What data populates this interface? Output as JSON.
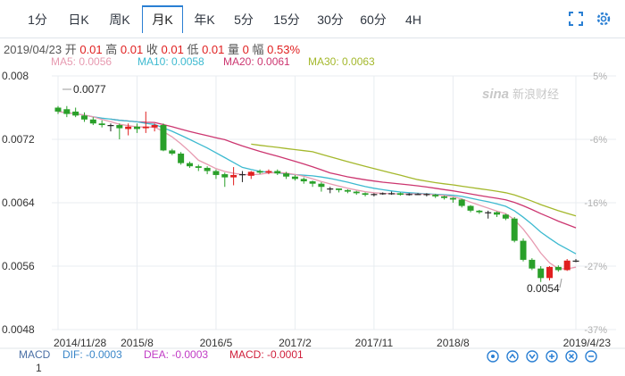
{
  "tabs": [
    "1分",
    "日K",
    "周K",
    "月K",
    "年K",
    "5分",
    "15分",
    "30分",
    "60分",
    "4H"
  ],
  "active_tab_index": 3,
  "info": {
    "date": "2019/04/23",
    "open_label": "开",
    "open": "0.01",
    "high_label": "高",
    "high": "0.01",
    "close_label": "收",
    "close": "0.01",
    "low_label": "低",
    "low": "0.01",
    "volume_label": "量",
    "volume": "0",
    "amp_label": "幅",
    "amp": "0.53%"
  },
  "ma": {
    "ma5": "MA5: 0.0056",
    "ma10": "MA10: 0.0058",
    "ma20": "MA20: 0.0061",
    "ma30": "MA30: 0.0063"
  },
  "colors": {
    "up": "#e02020",
    "down": "#2aa02a",
    "ma5": "#e79ab0",
    "ma10": "#3dbad0",
    "ma20": "#cc3670",
    "ma30": "#a4b82c",
    "macd_label": "#4a6fa5",
    "accent": "#2a7fd3"
  },
  "icons": {
    "fullscreen": "fullscreen-icon",
    "settings": "settings-icon"
  },
  "watermark": "新浪财经",
  "macd": {
    "title": "MACD",
    "dif": "DIF: -0.0003",
    "dea": "DEA: -0.0003",
    "macd": "MACD: -0.0001",
    "axis_top": "1"
  },
  "chart_data": {
    "type": "candlestick",
    "y_ticks": [
      "0.008",
      "0.0072",
      "0.0064",
      "0.0056",
      "0.0048"
    ],
    "pct_ticks": [
      "5%",
      "-6%",
      "-16%",
      "-27%",
      "-37%"
    ],
    "x_ticks": [
      "2014/11/28",
      "2015/8",
      "2016/5",
      "2017/2",
      "2017/11",
      "2018/8",
      "2019/4/23"
    ],
    "annotations": {
      "max": "0.0077",
      "min": "0.0054"
    },
    "ylim": [
      0.0048,
      0.008
    ],
    "candles": [
      [
        0.0076,
        0.00755,
        0.00762,
        0.00752
      ],
      [
        0.00758,
        0.00752,
        0.00762,
        0.00748
      ],
      [
        0.00755,
        0.0075,
        0.0076,
        0.00748
      ],
      [
        0.0075,
        0.00745,
        0.00754,
        0.00742
      ],
      [
        0.00745,
        0.0074,
        0.00748,
        0.00738
      ],
      [
        0.0074,
        0.00738,
        0.00744,
        0.00735
      ],
      [
        0.00738,
        0.00738,
        0.0074,
        0.0073
      ],
      [
        0.00738,
        0.00734,
        0.0074,
        0.0072
      ],
      [
        0.00733,
        0.00736,
        0.0074,
        0.00725
      ],
      [
        0.00736,
        0.00733,
        0.0074,
        0.00728
      ],
      [
        0.00734,
        0.00736,
        0.00755,
        0.00728
      ],
      [
        0.00735,
        0.00738,
        0.0074,
        0.0073
      ],
      [
        0.00738,
        0.00706,
        0.0074,
        0.00705
      ],
      [
        0.00706,
        0.00702,
        0.00708,
        0.007
      ],
      [
        0.00702,
        0.0069,
        0.00704,
        0.00688
      ],
      [
        0.0069,
        0.00686,
        0.00692,
        0.00684
      ],
      [
        0.00686,
        0.00684,
        0.00688,
        0.0068
      ],
      [
        0.00684,
        0.0068,
        0.00686,
        0.00676
      ],
      [
        0.0068,
        0.00675,
        0.00682,
        0.0067
      ],
      [
        0.00676,
        0.00672,
        0.00678,
        0.0066
      ],
      [
        0.00672,
        0.00675,
        0.00685,
        0.00662
      ],
      [
        0.00676,
        0.00676,
        0.0068,
        0.00666
      ],
      [
        0.00674,
        0.00679,
        0.0068,
        0.0067
      ],
      [
        0.0068,
        0.00678,
        0.00682,
        0.00676
      ],
      [
        0.00678,
        0.0068,
        0.00682,
        0.00676
      ],
      [
        0.0068,
        0.00677,
        0.00682,
        0.00675
      ],
      [
        0.00677,
        0.00673,
        0.00679,
        0.0067
      ],
      [
        0.00673,
        0.0067,
        0.00675,
        0.00668
      ],
      [
        0.0067,
        0.00667,
        0.00672,
        0.00664
      ],
      [
        0.00667,
        0.00664,
        0.00668,
        0.0066
      ],
      [
        0.00664,
        0.0066,
        0.00666,
        0.00654
      ],
      [
        0.00658,
        0.00658,
        0.0066,
        0.00652
      ],
      [
        0.00658,
        0.00656,
        0.00658,
        0.00653
      ],
      [
        0.00656,
        0.00654,
        0.00657,
        0.00652
      ],
      [
        0.00654,
        0.00652,
        0.00655,
        0.0065
      ],
      [
        0.00652,
        0.0065,
        0.00653,
        0.00648
      ],
      [
        0.0065,
        0.00651,
        0.00652,
        0.00648
      ],
      [
        0.00651,
        0.00652,
        0.00653,
        0.0065
      ],
      [
        0.00652,
        0.00652,
        0.00654,
        0.0065
      ],
      [
        0.00652,
        0.0065,
        0.00653,
        0.00649
      ],
      [
        0.0065,
        0.00651,
        0.00652,
        0.00649
      ],
      [
        0.00651,
        0.00651,
        0.00652,
        0.0065
      ],
      [
        0.00651,
        0.0065,
        0.00652,
        0.00648
      ],
      [
        0.0065,
        0.00648,
        0.00651,
        0.00646
      ],
      [
        0.00648,
        0.00646,
        0.00649,
        0.00644
      ],
      [
        0.00646,
        0.00644,
        0.00647,
        0.0064
      ],
      [
        0.00644,
        0.00636,
        0.00645,
        0.00634
      ],
      [
        0.00636,
        0.0063,
        0.00637,
        0.00628
      ],
      [
        0.0063,
        0.00628,
        0.00631,
        0.00626
      ],
      [
        0.00628,
        0.00628,
        0.0063,
        0.0062
      ],
      [
        0.00628,
        0.00625,
        0.00629,
        0.00622
      ],
      [
        0.00625,
        0.0062,
        0.00626,
        0.00618
      ],
      [
        0.0062,
        0.00592,
        0.00622,
        0.0059
      ],
      [
        0.00592,
        0.00568,
        0.00595,
        0.00566
      ],
      [
        0.00568,
        0.00557,
        0.0057,
        0.00555
      ],
      [
        0.00557,
        0.00545,
        0.0056,
        0.0054
      ],
      [
        0.00545,
        0.00559,
        0.0056,
        0.00542
      ],
      [
        0.00559,
        0.00555,
        0.00561,
        0.00553
      ],
      [
        0.00555,
        0.00567,
        0.00569,
        0.00554
      ],
      [
        0.00567,
        0.00567,
        0.00569,
        0.00565
      ]
    ]
  }
}
